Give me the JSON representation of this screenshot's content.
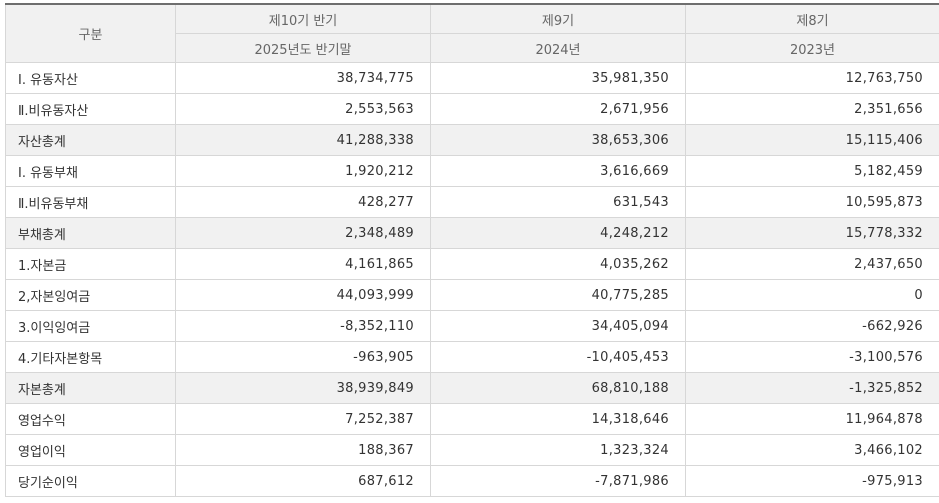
{
  "header": {
    "category_label": "구분",
    "periods": [
      {
        "name": "제10기 반기",
        "date": "2025년도 반기말"
      },
      {
        "name": "제9기",
        "date": "2024년"
      },
      {
        "name": "제8기",
        "date": "2023년"
      }
    ]
  },
  "rows": [
    {
      "label": "Ⅰ. 유동자산",
      "values": [
        "38,734,775",
        "35,981,350",
        "12,763,750"
      ]
    },
    {
      "label": "Ⅱ.비유동자산",
      "values": [
        "2,553,563",
        "2,671,956",
        "2,351,656"
      ]
    },
    {
      "label": "자산총계",
      "values": [
        "41,288,338",
        "38,653,306",
        "15,115,406"
      ]
    },
    {
      "label": "Ⅰ. 유동부채",
      "values": [
        "1,920,212",
        "3,616,669",
        "5,182,459"
      ]
    },
    {
      "label": "Ⅱ.비유동부채",
      "values": [
        "428,277",
        "631,543",
        "10,595,873"
      ]
    },
    {
      "label": "부채총계",
      "values": [
        "2,348,489",
        "4,248,212",
        "15,778,332"
      ]
    },
    {
      "label": "1.자본금",
      "values": [
        "4,161,865",
        "4,035,262",
        "2,437,650"
      ]
    },
    {
      "label": "2,자본잉여금",
      "values": [
        "44,093,999",
        "40,775,285",
        "0"
      ]
    },
    {
      "label": "3.이익잉여금",
      "values": [
        "-8,352,110",
        "34,405,094",
        "-662,926"
      ]
    },
    {
      "label": "4.기타자본항목",
      "values": [
        "-963,905",
        "-10,405,453",
        "-3,100,576"
      ]
    },
    {
      "label": "자본총계",
      "values": [
        "38,939,849",
        "68,810,188",
        "-1,325,852"
      ]
    },
    {
      "label": "영업수익",
      "values": [
        "7,252,387",
        "14,318,646",
        "11,964,878"
      ]
    },
    {
      "label": "영업이익",
      "values": [
        "188,367",
        "1,323,324",
        "3,466,102"
      ]
    },
    {
      "label": "당기순이익",
      "values": [
        "687,612",
        "-7,871,986",
        "-975,913"
      ]
    }
  ]
}
